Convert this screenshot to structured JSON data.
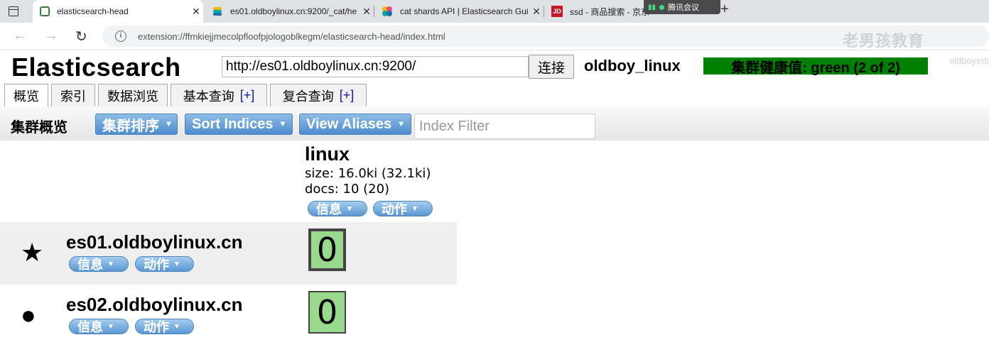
{
  "browser": {
    "tabs": [
      {
        "title": "elasticsearch-head",
        "active": true,
        "icon": "elasticsearch-head-icon"
      },
      {
        "title": "es01.oldboylinux.cn:9200/_cat/he",
        "active": false,
        "icon": "elastic-icon"
      },
      {
        "title": "cat shards API | Elasticsearch Gui",
        "active": false,
        "icon": "elastic-guide-icon"
      },
      {
        "title": "ssd - 商品搜索 - 京东",
        "active": false,
        "icon": "jd-icon"
      }
    ],
    "meeting_label": "腾讯会议",
    "address": "extension://ffmkiejjmecolpfloofpjologoblkegm/elasticsearch-head/index.html",
    "watermark": "老男孩教育",
    "watermark_sub": "oldboyedu.com"
  },
  "header": {
    "title": "Elasticsearch",
    "cluster_url": "http://es01.oldboylinux.cn:9200/",
    "connect_label": "连接",
    "cluster_name": "oldboy_linux",
    "health_text": "集群健康值: green (2 of 2)",
    "health_color": "#008000"
  },
  "tabs": [
    {
      "label": "概览",
      "plus": ""
    },
    {
      "label": "索引",
      "plus": ""
    },
    {
      "label": "数据浏览",
      "plus": ""
    },
    {
      "label": "基本查询",
      "plus": "[+]"
    },
    {
      "label": "复合查询",
      "plus": "[+]"
    }
  ],
  "toolbar": {
    "label": "集群概览",
    "sort_cluster": "集群排序",
    "sort_indices": "Sort Indices",
    "view_aliases": "View Aliases",
    "filter_placeholder": "Index Filter"
  },
  "index": {
    "name": "linux",
    "size": "size: 16.0ki (32.1ki)",
    "docs": "docs: 10 (20)",
    "info_label": "信息",
    "action_label": "动作"
  },
  "nodes": [
    {
      "name": "es01.oldboylinux.cn",
      "icon": "★",
      "role": "master",
      "info_label": "信息",
      "action_label": "动作",
      "shard": "0",
      "shard_type": "primary"
    },
    {
      "name": "es02.oldboylinux.cn",
      "icon": "●",
      "role": "data",
      "info_label": "信息",
      "action_label": "动作",
      "shard": "0",
      "shard_type": "replica"
    }
  ]
}
